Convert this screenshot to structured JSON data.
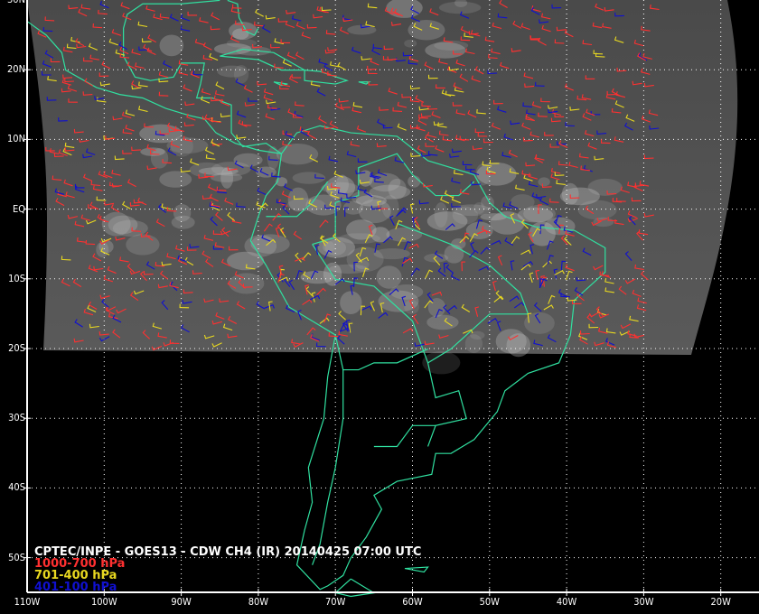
{
  "title": "CPTEC/INPE - GOES13 - CDW CH4 (IR) 20140425 07:00 UTC",
  "legend": [
    {
      "label": "1000-700 hPa",
      "color": "#ff3030"
    },
    {
      "label": "701-400 hPa",
      "color": "#e8d820"
    },
    {
      "label": "401-100 hPa",
      "color": "#1010d0"
    }
  ],
  "y_axis": [
    "30N",
    "20N",
    "10N",
    "EQ",
    "10S",
    "20S",
    "30S",
    "40S",
    "50S"
  ],
  "x_axis": [
    "110W",
    "100W",
    "90W",
    "80W",
    "70W",
    "60W",
    "50W",
    "40W",
    "30W",
    "20W"
  ],
  "colors": {
    "coastline": "#30e0a0",
    "grid": "#ffffff",
    "background": "#000000"
  }
}
